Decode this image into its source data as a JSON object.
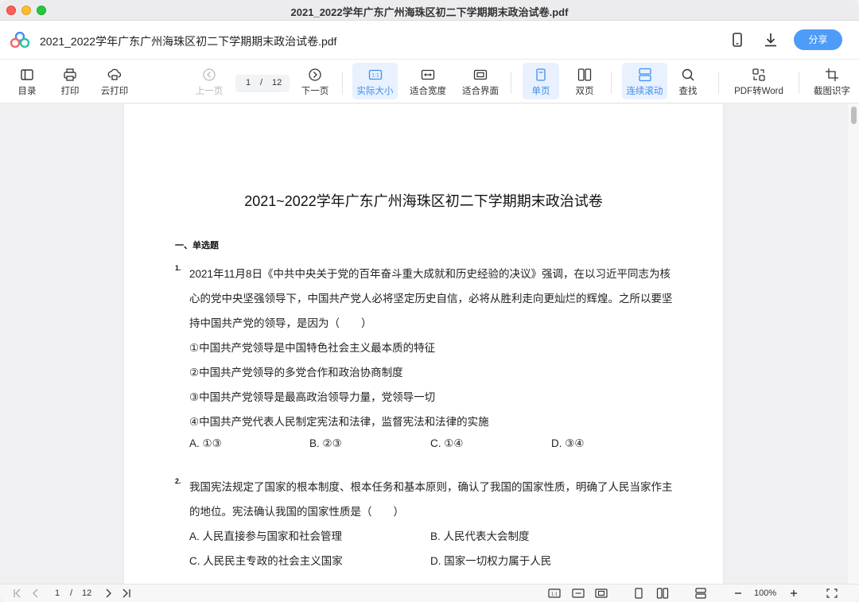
{
  "window": {
    "title": "2021_2022学年广东广州海珠区初二下学期期末政治试卷.pdf"
  },
  "header": {
    "file_name": "2021_2022学年广东广州海珠区初二下学期期末政治试卷.pdf",
    "share_label": "分享"
  },
  "toolbar": {
    "toc": "目录",
    "print": "打印",
    "cloud_print": "云打印",
    "prev_page": "上一页",
    "current_page": "1",
    "page_sep": "/",
    "total_pages": "12",
    "next_page": "下一页",
    "actual_size": "实际大小",
    "fit_width": "适合宽度",
    "fit_page": "适合界面",
    "single_page": "单页",
    "double_page": "双页",
    "continuous": "连续滚动",
    "find": "查找",
    "pdf_to_word": "PDF转Word",
    "ocr": "截图识字"
  },
  "document": {
    "title": "2021~2022学年广东广州海珠区初二下学期期末政治试卷",
    "section": "一、单选题",
    "q1": {
      "num": "1.",
      "lines": [
        "2021年11月8日《中共中央关于党的百年奋斗重大成就和历史经验的决议》强调，在以习近平同志为核",
        "心的党中央坚强领导下，中国共产党人必将坚定历史自信，必将从胜利走向更灿烂的辉煌。之所以要坚",
        "持中国共产党的领导，是因为（　　）",
        "①中国共产党领导是中国特色社会主义最本质的特征",
        "②中国共产党领导的多党合作和政治协商制度",
        "③中国共产党领导是最高政治领导力量，党领导一切",
        "④中国共产党代表人民制定宪法和法律，监督宪法和法律的实施"
      ],
      "options": [
        "A. ①③",
        "B. ②③",
        "C. ①④",
        "D. ③④"
      ]
    },
    "q2": {
      "num": "2.",
      "lines": [
        "我国宪法规定了国家的根本制度、根本任务和基本原则，确认了我国的国家性质，明确了人民当家作主",
        "的地位。宪法确认我国的国家性质是（　　）"
      ],
      "options": [
        "A. 人民直接参与国家和社会管理",
        "B. 人民代表大会制度",
        "C. 人民民主专政的社会主义国家",
        "D. 国家一切权力属于人民"
      ]
    }
  },
  "statusbar": {
    "current_page": "1",
    "page_sep": "/",
    "total_pages": "12",
    "zoom": "100%"
  },
  "colors": {
    "accent": "#4d9cf8",
    "active_bg": "#e8f1fd"
  }
}
